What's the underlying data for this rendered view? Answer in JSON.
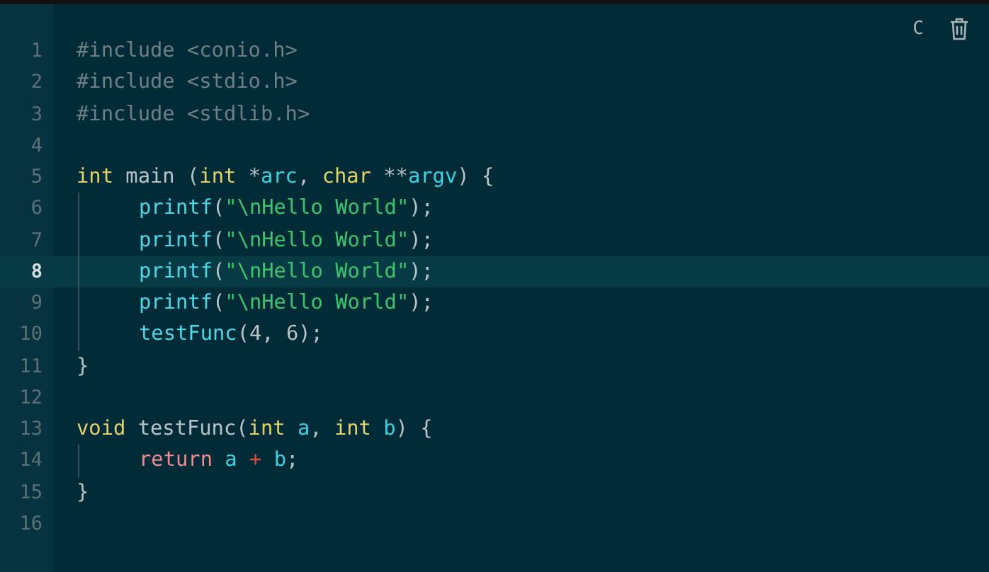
{
  "toolbar": {
    "language": "C"
  },
  "lines": [
    {
      "number": "1",
      "current": false,
      "indented": false,
      "tokens": [
        {
          "kind": "pre",
          "text": "#include <conio.h>"
        }
      ]
    },
    {
      "number": "2",
      "current": false,
      "indented": false,
      "tokens": [
        {
          "kind": "pre",
          "text": "#include <stdio.h>"
        }
      ]
    },
    {
      "number": "3",
      "current": false,
      "indented": false,
      "tokens": [
        {
          "kind": "pre",
          "text": "#include <stdlib.h>"
        }
      ]
    },
    {
      "number": "4",
      "current": false,
      "indented": false
    },
    {
      "number": "5",
      "current": false,
      "indented": false,
      "tokens": [
        {
          "kind": "type",
          "text": "int"
        },
        {
          "kind": "plain",
          "text": " main ("
        },
        {
          "kind": "type",
          "text": "int"
        },
        {
          "kind": "plain",
          "text": " *"
        },
        {
          "kind": "var",
          "text": "arc"
        },
        {
          "kind": "plain",
          "text": ", "
        },
        {
          "kind": "type",
          "text": "char"
        },
        {
          "kind": "plain",
          "text": " **"
        },
        {
          "kind": "var",
          "text": "argv"
        },
        {
          "kind": "plain",
          "text": ") {"
        }
      ]
    },
    {
      "number": "6",
      "current": false,
      "indented": true,
      "tokens": [
        {
          "kind": "func",
          "text": "printf"
        },
        {
          "kind": "plain",
          "text": "("
        },
        {
          "kind": "string",
          "text": "\"\\nHello World\""
        },
        {
          "kind": "plain",
          "text": ");"
        }
      ]
    },
    {
      "number": "7",
      "current": false,
      "indented": true,
      "tokens": [
        {
          "kind": "func",
          "text": "printf"
        },
        {
          "kind": "plain",
          "text": "("
        },
        {
          "kind": "string",
          "text": "\"\\nHello World\""
        },
        {
          "kind": "plain",
          "text": ");"
        }
      ]
    },
    {
      "number": "8",
      "current": true,
      "indented": true,
      "tokens": [
        {
          "kind": "func",
          "text": "printf"
        },
        {
          "kind": "plain",
          "text": "("
        },
        {
          "kind": "string",
          "text": "\"\\nHello World\""
        },
        {
          "kind": "plain",
          "text": ");"
        }
      ]
    },
    {
      "number": "9",
      "current": false,
      "indented": true,
      "tokens": [
        {
          "kind": "func",
          "text": "printf"
        },
        {
          "kind": "plain",
          "text": "("
        },
        {
          "kind": "string",
          "text": "\"\\nHello World\""
        },
        {
          "kind": "plain",
          "text": ");"
        }
      ]
    },
    {
      "number": "10",
      "current": false,
      "indented": true,
      "tokens": [
        {
          "kind": "func",
          "text": "testFunc"
        },
        {
          "kind": "plain",
          "text": "(4, 6);"
        }
      ]
    },
    {
      "number": "11",
      "current": false,
      "indented": false,
      "tokens": [
        {
          "kind": "plain",
          "text": "}"
        }
      ]
    },
    {
      "number": "12",
      "current": false,
      "indented": false
    },
    {
      "number": "13",
      "current": false,
      "indented": false,
      "tokens": [
        {
          "kind": "type",
          "text": "void"
        },
        {
          "kind": "plain",
          "text": " testFunc("
        },
        {
          "kind": "type",
          "text": "int "
        },
        {
          "kind": "var",
          "text": "a"
        },
        {
          "kind": "plain",
          "text": ", "
        },
        {
          "kind": "type",
          "text": "int "
        },
        {
          "kind": "var",
          "text": "b"
        },
        {
          "kind": "plain",
          "text": ") {"
        }
      ]
    },
    {
      "number": "14",
      "current": false,
      "indented": true,
      "tokens": [
        {
          "kind": "keyword",
          "text": "return "
        },
        {
          "kind": "var",
          "text": "a "
        },
        {
          "kind": "op",
          "text": "+ "
        },
        {
          "kind": "var",
          "text": "b"
        },
        {
          "kind": "plain",
          "text": ";"
        }
      ]
    },
    {
      "number": "15",
      "current": false,
      "indented": false,
      "tokens": [
        {
          "kind": "plain",
          "text": "}"
        }
      ]
    },
    {
      "number": "16",
      "current": false,
      "indented": false
    }
  ]
}
